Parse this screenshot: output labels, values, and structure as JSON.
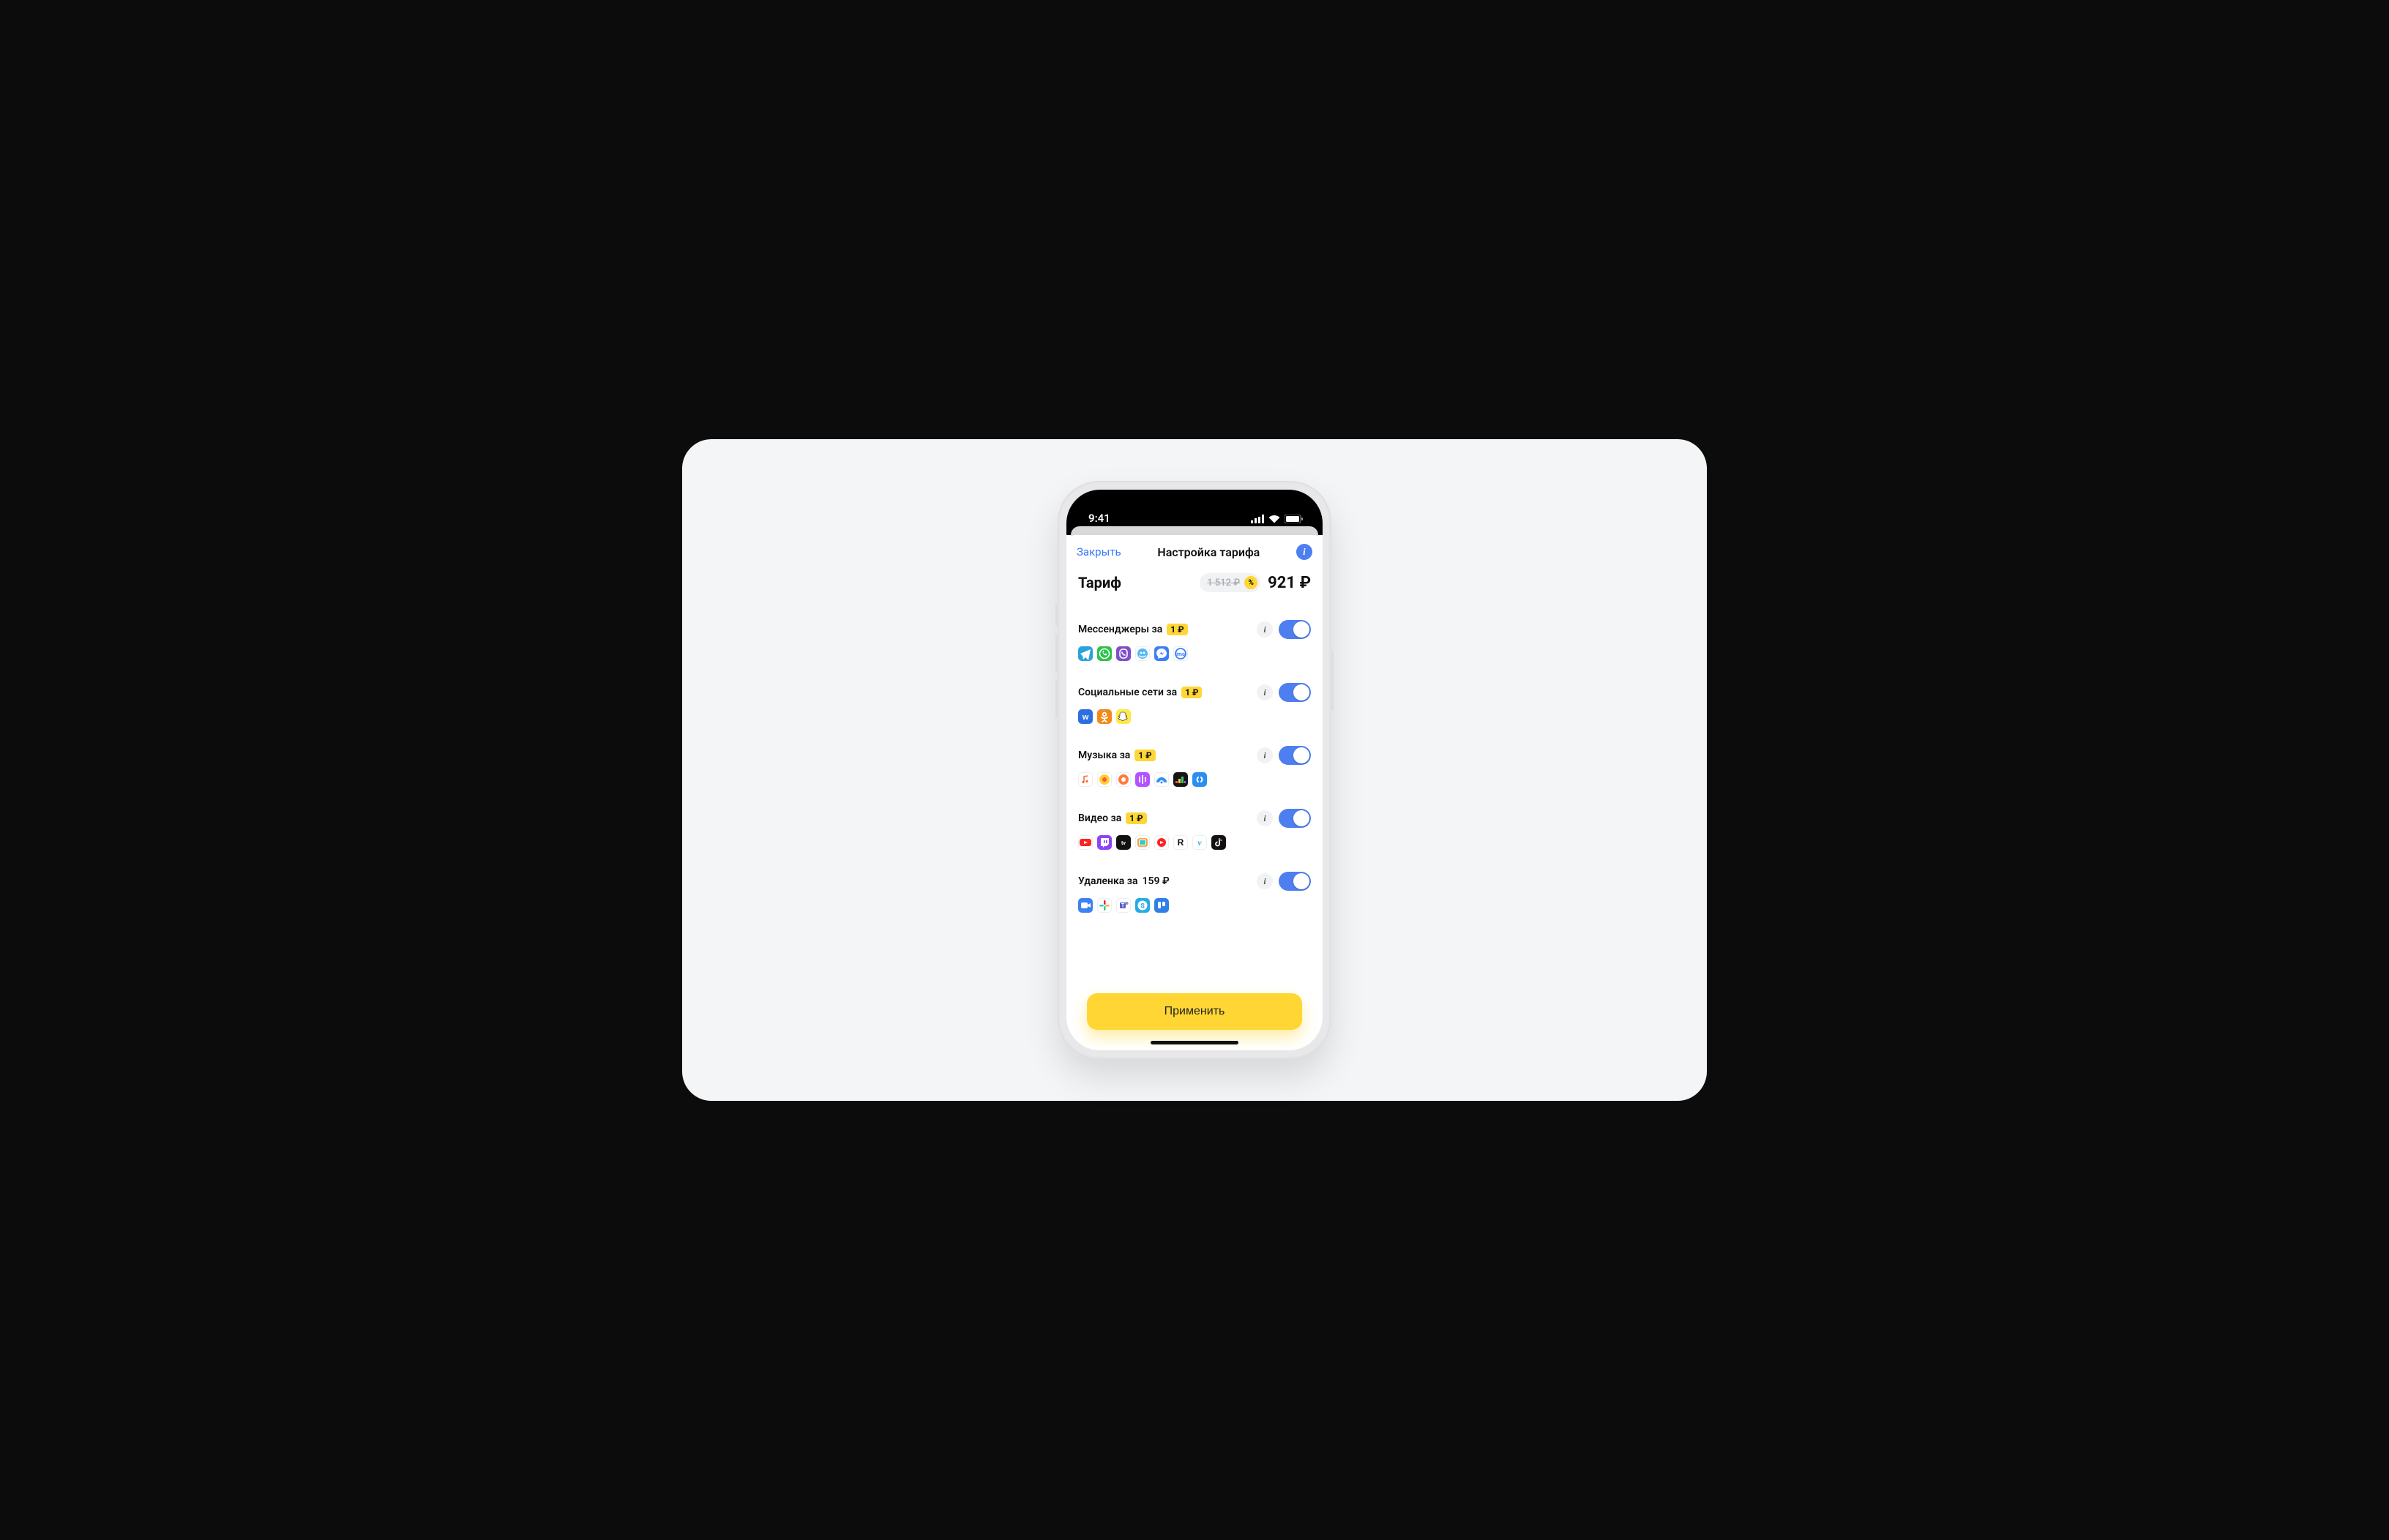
{
  "status": {
    "time": "9:41"
  },
  "nav": {
    "close": "Закрыть",
    "title": "Настройка тарифа"
  },
  "tariff": {
    "label": "Тариф",
    "old_price": "1 512 ₽",
    "discount_symbol": "%",
    "new_price": "921 ₽"
  },
  "options": [
    {
      "title": "Мессенджеры за",
      "price": "1 ₽",
      "price_badge": true,
      "enabled": true,
      "icons": [
        {
          "name": "telegram",
          "bg": "#2aa2dd",
          "svg": "telegram"
        },
        {
          "name": "whatsapp",
          "bg": "#2ec24a",
          "svg": "whatsapp"
        },
        {
          "name": "viber",
          "bg": "#7f4fc9",
          "svg": "viber"
        },
        {
          "name": "tamtam",
          "bg": "#ffffff",
          "svg": "tamtam"
        },
        {
          "name": "messenger",
          "bg": "#3b7ff5",
          "svg": "messenger"
        },
        {
          "name": "imo",
          "bg": "#ffffff",
          "svg": "imo"
        }
      ]
    },
    {
      "title": "Социальные сети за",
      "price": "1 ₽",
      "price_badge": true,
      "enabled": true,
      "icons": [
        {
          "name": "vk",
          "bg": "#2d6fe0",
          "svg": "vk"
        },
        {
          "name": "ok",
          "bg": "#f28a1a",
          "svg": "ok"
        },
        {
          "name": "snapchat",
          "bg": "#ffe84a",
          "svg": "snapchat"
        }
      ]
    },
    {
      "title": "Музыка за",
      "price": "1 ₽",
      "price_badge": true,
      "enabled": true,
      "icons": [
        {
          "name": "apple-music",
          "bg": "#ffffff",
          "svg": "applemusic"
        },
        {
          "name": "yandex-music",
          "bg": "#ffffff",
          "svg": "yamusic"
        },
        {
          "name": "boom",
          "bg": "#ffffff",
          "svg": "boom"
        },
        {
          "name": "zvuk",
          "bg": "#b552ff",
          "svg": "zvuk"
        },
        {
          "name": "podcast",
          "bg": "#ffffff",
          "svg": "podcast"
        },
        {
          "name": "deezer",
          "bg": "#16161a",
          "svg": "deezer"
        },
        {
          "name": "shazam",
          "bg": "#2c8ef0",
          "svg": "shazam"
        }
      ]
    },
    {
      "title": "Видео за",
      "price": "1 ₽",
      "price_badge": true,
      "enabled": true,
      "icons": [
        {
          "name": "youtube",
          "bg": "#ffffff",
          "svg": "youtube"
        },
        {
          "name": "twitch",
          "bg": "#8d44f7",
          "svg": "twitch"
        },
        {
          "name": "apple-tv",
          "bg": "#111111",
          "svg": "appletv"
        },
        {
          "name": "kinopoisk",
          "bg": "#ffffff",
          "svg": "kinopoisk"
        },
        {
          "name": "yt-shorts",
          "bg": "#ffffff",
          "svg": "ytred"
        },
        {
          "name": "rutube",
          "bg": "#ffffff",
          "svg": "rutube"
        },
        {
          "name": "vimeo",
          "bg": "#ffffff",
          "svg": "vimeo"
        },
        {
          "name": "tiktok",
          "bg": "#111111",
          "svg": "tiktok"
        }
      ]
    },
    {
      "title": "Удаленка за",
      "price": "159 ₽",
      "price_badge": false,
      "enabled": true,
      "icons": [
        {
          "name": "zoom",
          "bg": "#3c82f4",
          "svg": "zoom"
        },
        {
          "name": "slack",
          "bg": "#ffffff",
          "svg": "slack"
        },
        {
          "name": "teams",
          "bg": "#ffffff",
          "svg": "teams"
        },
        {
          "name": "skype",
          "bg": "#25ade3",
          "svg": "skype"
        },
        {
          "name": "trello",
          "bg": "#2f7fe6",
          "svg": "trello"
        }
      ]
    }
  ],
  "apply": "Применить"
}
